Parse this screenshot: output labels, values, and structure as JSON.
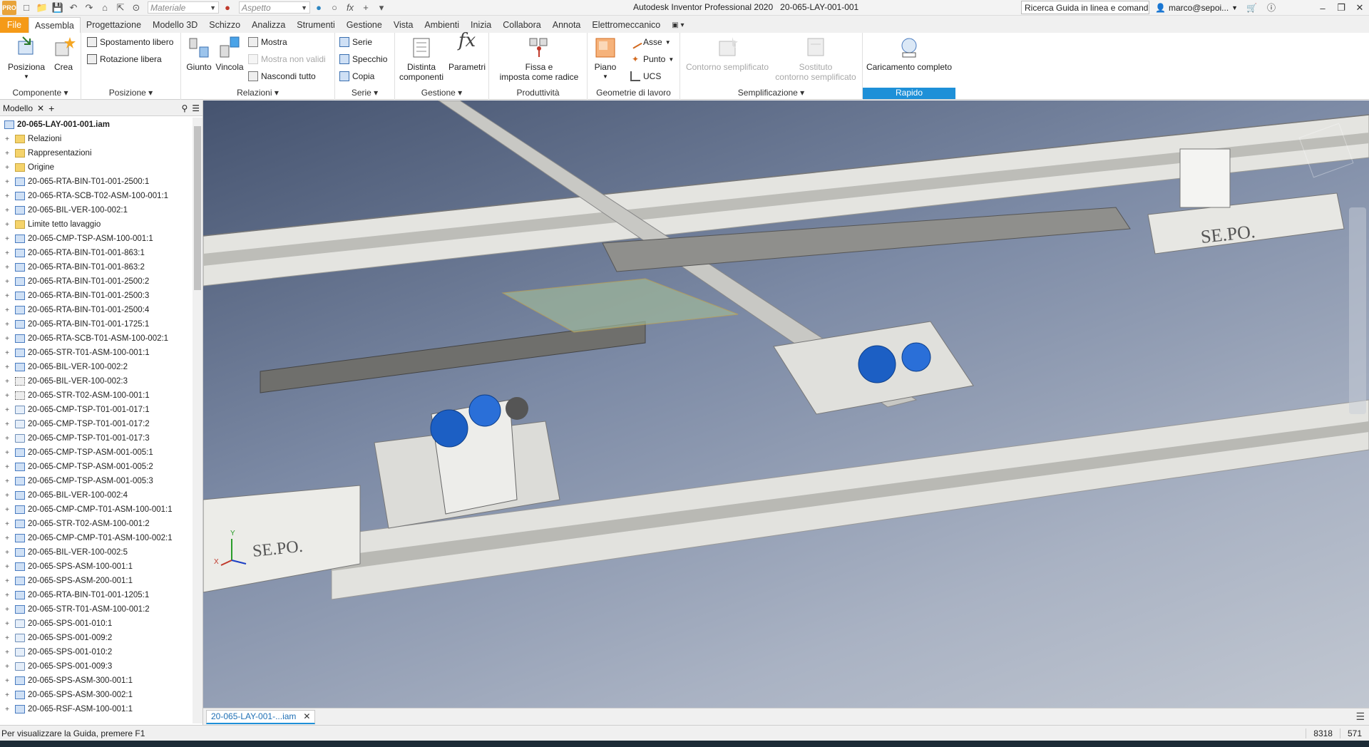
{
  "titlebar": {
    "logo": "PRO",
    "material_combo": "Materiale",
    "appearance_combo": "Aspetto",
    "title": "Autodesk Inventor Professional 2020",
    "document": "20-065-LAY-001-001",
    "help_search": "Ricerca Guida in linea e comand",
    "user": "marco@sepoi...",
    "icons": [
      "new-icon",
      "open-icon",
      "save-icon",
      "undo-icon",
      "redo-icon",
      "home-icon",
      "select-icon",
      "cart-icon",
      "help-icon"
    ]
  },
  "tabs": [
    "File",
    "Assembla",
    "Progettazione",
    "Modello 3D",
    "Schizzo",
    "Analizza",
    "Strumenti",
    "Gestione",
    "Vista",
    "Ambienti",
    "Inizia",
    "Collabora",
    "Annota",
    "Elettromeccanico"
  ],
  "ribbon": {
    "componente": {
      "title": "Componente",
      "posiziona": "Posiziona",
      "crea": "Crea"
    },
    "posizione": {
      "title": "Posizione",
      "spostamento": "Spostamento libero",
      "rotazione": "Rotazione libera"
    },
    "relazioni": {
      "title": "Relazioni",
      "giunto": "Giunto",
      "vincola": "Vincola",
      "mostra": "Mostra",
      "mostra_non_validi": "Mostra non validi",
      "nascondi_tutto": "Nascondi tutto"
    },
    "serie": {
      "title": "Serie",
      "serie": "Serie",
      "specchio": "Specchio",
      "copia": "Copia"
    },
    "gestione": {
      "title": "Gestione",
      "distinta_1": "Distinta",
      "distinta_2": "componenti",
      "parametri": "Parametri"
    },
    "produttivita": {
      "title": "Produttività",
      "fissa_1": "Fissa e",
      "fissa_2": "imposta come radice"
    },
    "geometrie": {
      "title": "Geometrie di lavoro",
      "piano": "Piano",
      "asse": "Asse",
      "punto": "Punto",
      "ucs": "UCS"
    },
    "semplificazione": {
      "title": "Semplificazione",
      "contorno": "Contorno semplificato",
      "sostituto_1": "Sostituto",
      "sostituto_2": "contorno semplificato"
    },
    "rapido": {
      "title": "Rapido",
      "caricamento": "Caricamento completo"
    }
  },
  "browser": {
    "title": "Modello",
    "root": "20-065-LAY-001-001.iam",
    "items": [
      {
        "label": "Relazioni",
        "type": "folder"
      },
      {
        "label": "Rappresentazioni",
        "type": "folder"
      },
      {
        "label": "Origine",
        "type": "folder"
      },
      {
        "label": "20-065-RTA-BIN-T01-001-2500:1",
        "type": "asm"
      },
      {
        "label": "20-065-RTA-SCB-T02-ASM-100-001:1",
        "type": "asm"
      },
      {
        "label": "20-065-BIL-VER-100-002:1",
        "type": "asm"
      },
      {
        "label": "Limite tetto lavaggio",
        "type": "folder"
      },
      {
        "label": "20-065-CMP-TSP-ASM-100-001:1",
        "type": "asm"
      },
      {
        "label": "20-065-RTA-BIN-T01-001-863:1",
        "type": "asm"
      },
      {
        "label": "20-065-RTA-BIN-T01-001-863:2",
        "type": "asm"
      },
      {
        "label": "20-065-RTA-BIN-T01-001-2500:2",
        "type": "asm"
      },
      {
        "label": "20-065-RTA-BIN-T01-001-2500:3",
        "type": "asm"
      },
      {
        "label": "20-065-RTA-BIN-T01-001-2500:4",
        "type": "asm"
      },
      {
        "label": "20-065-RTA-BIN-T01-001-1725:1",
        "type": "asm"
      },
      {
        "label": "20-065-RTA-SCB-T01-ASM-100-002:1",
        "type": "asm"
      },
      {
        "label": "20-065-STR-T01-ASM-100-001:1",
        "type": "asm"
      },
      {
        "label": "20-065-BIL-VER-100-002:2",
        "type": "asm"
      },
      {
        "label": "20-065-BIL-VER-100-002:3",
        "type": "pattern"
      },
      {
        "label": "20-065-STR-T02-ASM-100-001:1",
        "type": "pattern"
      },
      {
        "label": "20-065-CMP-TSP-T01-001-017:1",
        "type": "part"
      },
      {
        "label": "20-065-CMP-TSP-T01-001-017:2",
        "type": "part"
      },
      {
        "label": "20-065-CMP-TSP-T01-001-017:3",
        "type": "part"
      },
      {
        "label": "20-065-CMP-TSP-ASM-001-005:1",
        "type": "asm"
      },
      {
        "label": "20-065-CMP-TSP-ASM-001-005:2",
        "type": "asm"
      },
      {
        "label": "20-065-CMP-TSP-ASM-001-005:3",
        "type": "asm"
      },
      {
        "label": "20-065-BIL-VER-100-002:4",
        "type": "asm"
      },
      {
        "label": "20-065-CMP-CMP-T01-ASM-100-001:1",
        "type": "asm"
      },
      {
        "label": "20-065-STR-T02-ASM-100-001:2",
        "type": "asm"
      },
      {
        "label": "20-065-CMP-CMP-T01-ASM-100-002:1",
        "type": "asm"
      },
      {
        "label": "20-065-BIL-VER-100-002:5",
        "type": "asm"
      },
      {
        "label": "20-065-SPS-ASM-100-001:1",
        "type": "asm"
      },
      {
        "label": "20-065-SPS-ASM-200-001:1",
        "type": "asm"
      },
      {
        "label": "20-065-RTA-BIN-T01-001-1205:1",
        "type": "asm"
      },
      {
        "label": "20-065-STR-T01-ASM-100-001:2",
        "type": "asm"
      },
      {
        "label": "20-065-SPS-001-010:1",
        "type": "part"
      },
      {
        "label": "20-065-SPS-001-009:2",
        "type": "part"
      },
      {
        "label": "20-065-SPS-001-010:2",
        "type": "part"
      },
      {
        "label": "20-065-SPS-001-009:3",
        "type": "part"
      },
      {
        "label": "20-065-SPS-ASM-300-001:1",
        "type": "asm"
      },
      {
        "label": "20-065-SPS-ASM-300-002:1",
        "type": "asm"
      },
      {
        "label": "20-065-RSF-ASM-100-001:1",
        "type": "asm"
      }
    ]
  },
  "viewport": {
    "brand_plate": "SE.PO.",
    "axis_y": "Y",
    "axis_x": "X"
  },
  "doc_tab": "20-065-LAY-001-...iam",
  "status": {
    "message": "Per visualizzare la Guida, premere F1",
    "count1": "8318",
    "count2": "571"
  },
  "colors": {
    "file_tab": "#f59a18",
    "rapido": "#1e90d8",
    "motor_blue": "#1c5fc4"
  }
}
